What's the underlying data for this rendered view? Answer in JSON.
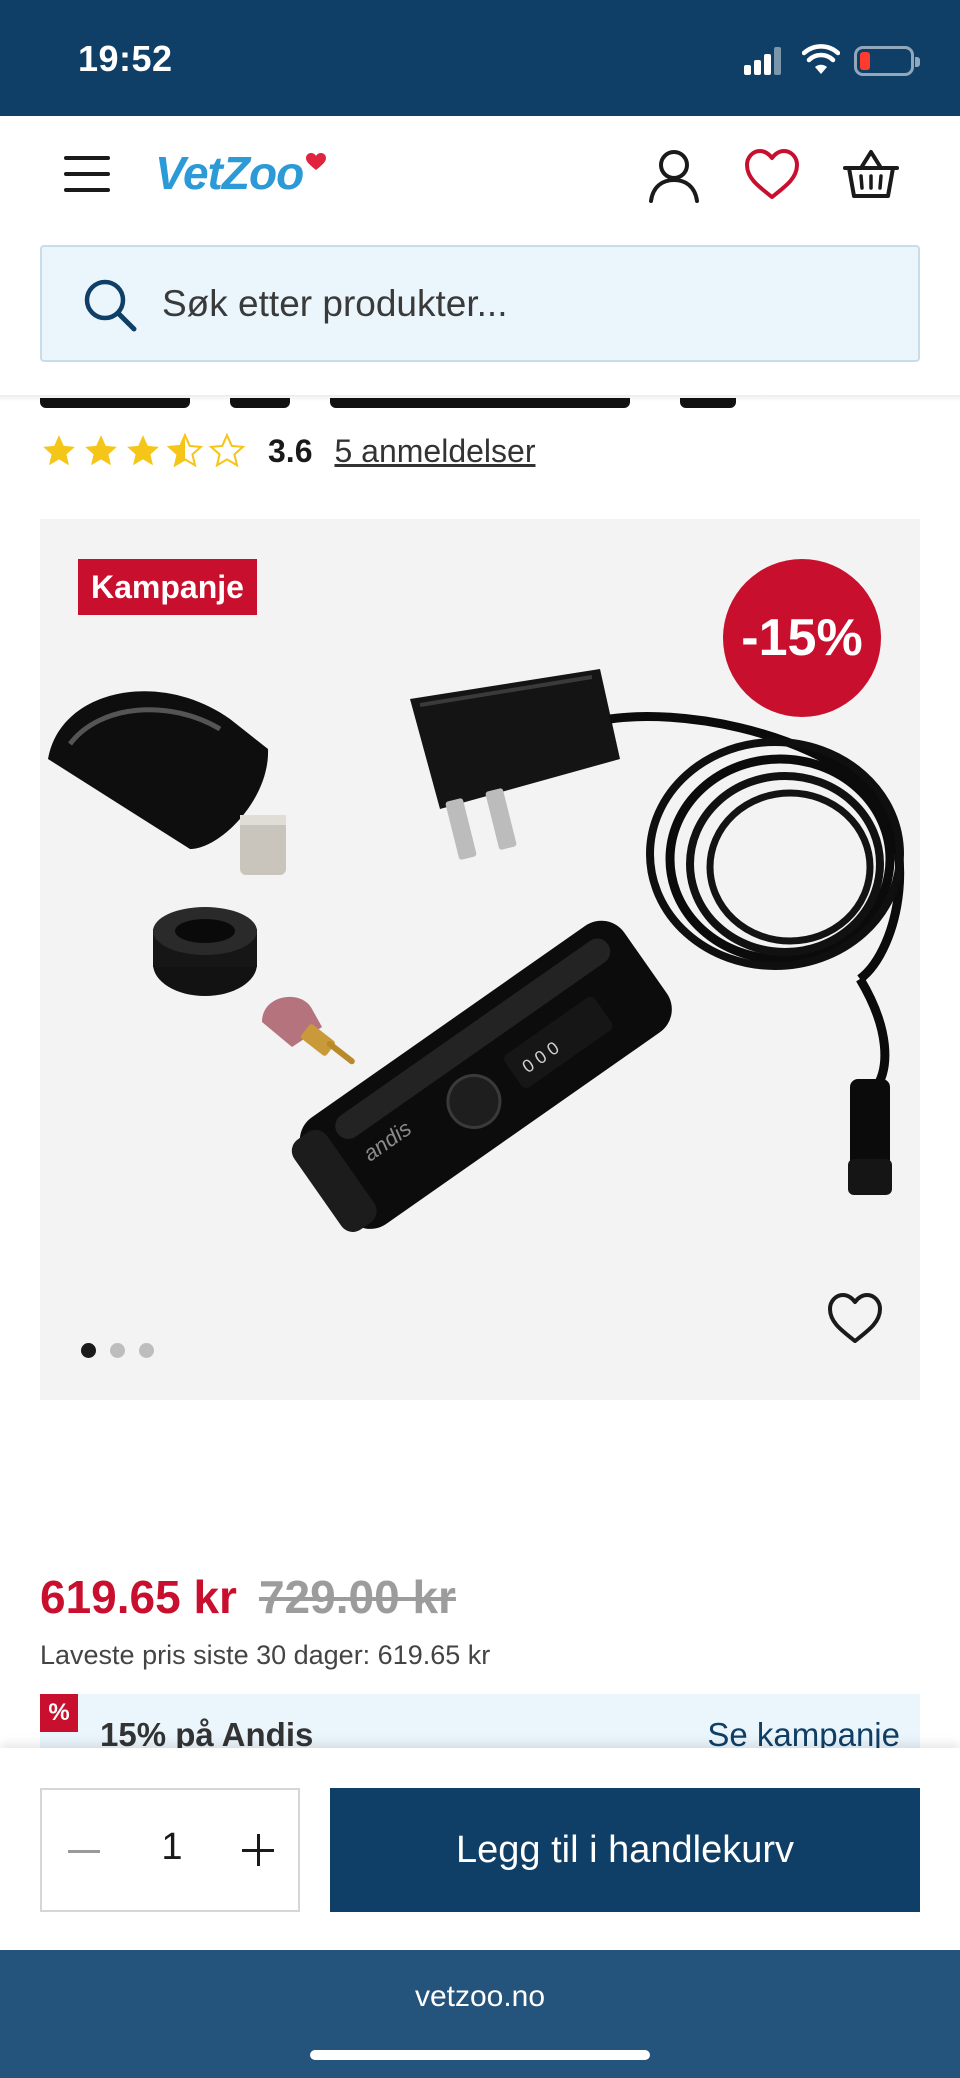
{
  "status_bar": {
    "time": "19:52"
  },
  "header": {
    "logo_text": "VetZoo",
    "icons": [
      "menu-icon",
      "account-icon",
      "heart-icon",
      "basket-icon"
    ]
  },
  "search": {
    "placeholder": "Søk etter produkter..."
  },
  "rating": {
    "value": "3.6",
    "stars": 3.5,
    "reviews_link": "5 anmeldelser"
  },
  "product_image": {
    "campaign_badge": "Kampanje",
    "discount_badge": "-15%",
    "carousel": {
      "count": 3,
      "active": 1
    }
  },
  "price": {
    "current": "619.65 kr",
    "original": "729.00 kr",
    "lowest_30_days": "Laveste pris siste 30 dager: 619.65 kr"
  },
  "campaign": {
    "badge": "%",
    "text": "15% på Andis",
    "link": "Se kampanje"
  },
  "cart": {
    "quantity": "1",
    "add_button": "Legg til i handlekurv"
  },
  "browser": {
    "url": "vetzoo.no"
  },
  "colors": {
    "brand_navy": "#0f3f66",
    "sale_red": "#c8102e",
    "logo_blue": "#2b9ad6",
    "star_yellow": "#f5c518",
    "search_bg": "#eaf5fc"
  }
}
